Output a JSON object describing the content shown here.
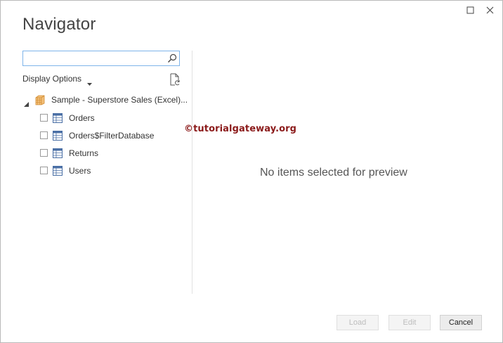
{
  "window": {
    "title": "Navigator"
  },
  "search": {
    "value": "",
    "placeholder": ""
  },
  "display_options": {
    "label": "Display Options"
  },
  "tree": {
    "root": {
      "label": "Sample - Superstore Sales (Excel)...",
      "expanded": true
    },
    "items": [
      {
        "label": "Orders",
        "checked": false
      },
      {
        "label": "Orders$FilterDatabase",
        "checked": false
      },
      {
        "label": "Returns",
        "checked": false
      },
      {
        "label": "Users",
        "checked": false
      }
    ]
  },
  "preview": {
    "empty_message": "No items selected for preview"
  },
  "watermark": {
    "text": "©tutorialgateway.org"
  },
  "buttons": {
    "load": "Load",
    "edit": "Edit",
    "cancel": "Cancel"
  },
  "colors": {
    "search_border": "#7eb4ea",
    "db_icon": "#e0a050",
    "watermark": "#8b1a1a"
  }
}
